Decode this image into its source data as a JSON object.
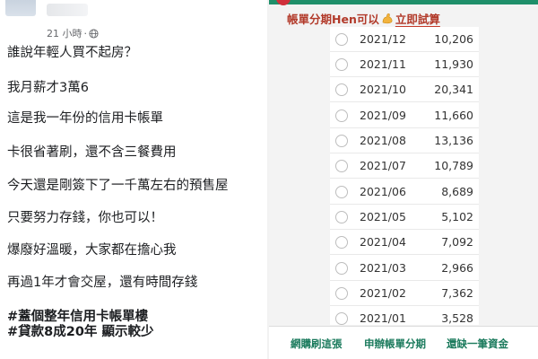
{
  "post": {
    "timestamp": "21 小時",
    "separator": "·",
    "lines": [
      "誰說年輕人買不起房？",
      "我月薪才3萬6",
      "這是我一年份的信用卡帳單",
      "卡很省著刷，還不含三餐費用",
      "今天還是剛簽下了一千萬左右的預售屋",
      "只要努力存錢，你也可以！",
      "爆廢好溫暖，大家都在擔心我",
      "再過1年才會交屋，還有時間存錢"
    ],
    "hashtags": [
      "#蓋個整年信用卡帳單樓",
      "#貸款8成20年 顯示較少"
    ]
  },
  "app": {
    "promo": {
      "text": "帳單分期Hen可以",
      "icon": "flexed-biceps-icon",
      "cta": "立即試算"
    },
    "bills": [
      {
        "month": "2021/12",
        "amount": "10,206"
      },
      {
        "month": "2021/11",
        "amount": "11,930"
      },
      {
        "month": "2021/10",
        "amount": "20,341"
      },
      {
        "month": "2021/09",
        "amount": "11,660"
      },
      {
        "month": "2021/08",
        "amount": "13,136"
      },
      {
        "month": "2021/07",
        "amount": "10,789"
      },
      {
        "month": "2021/06",
        "amount": "8,689"
      },
      {
        "month": "2021/05",
        "amount": "5,102"
      },
      {
        "month": "2021/04",
        "amount": "7,092"
      },
      {
        "month": "2021/03",
        "amount": "2,966"
      },
      {
        "month": "2021/02",
        "amount": "7,362"
      },
      {
        "month": "2021/01",
        "amount": "3,528"
      }
    ],
    "bottom_buttons": [
      "網購刷這張",
      "申辦帳單分期",
      "還缺一筆資金"
    ],
    "colors": {
      "accent_green": "#1a7a5c",
      "promo_red": "#b23a2a",
      "list_bg": "#ffffff",
      "page_bg": "#f3f3f3"
    }
  }
}
